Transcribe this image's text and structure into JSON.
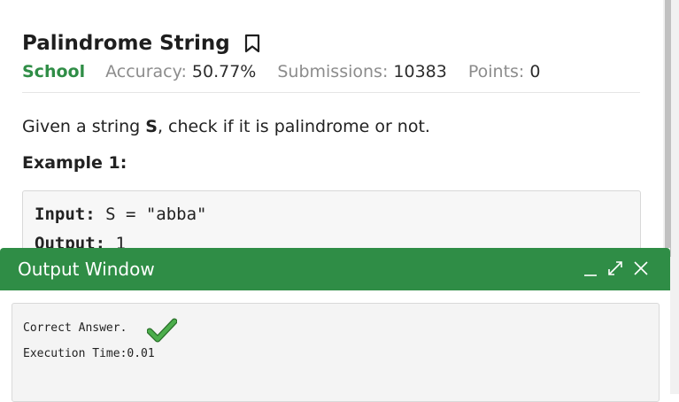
{
  "problem": {
    "title": "Palindrome String",
    "difficulty": "School",
    "accuracy_label": "Accuracy:",
    "accuracy_value": "50.77%",
    "submissions_label": "Submissions:",
    "submissions_value": "10383",
    "points_label": "Points:",
    "points_value": "0",
    "statement_prefix": "Given a string ",
    "statement_var": "S",
    "statement_suffix": ", check if it is palindrome or not.",
    "example_heading": "Example 1:",
    "example_input_label": "Input:",
    "example_input_value": " S = \"abba\"",
    "example_output_label": "Output:",
    "example_output_value": " 1"
  },
  "output_window": {
    "title": "Output Window",
    "result": "Correct Answer.",
    "execution_time": "Execution Time:0.01"
  },
  "icons": {
    "bookmark": "bookmark-icon",
    "minimize": "minimize-icon",
    "expand": "expand-icon",
    "close": "close-icon",
    "check": "checkmark-icon"
  },
  "colors": {
    "brand_green": "#2f8d46",
    "muted_text": "#8c8c8c"
  }
}
